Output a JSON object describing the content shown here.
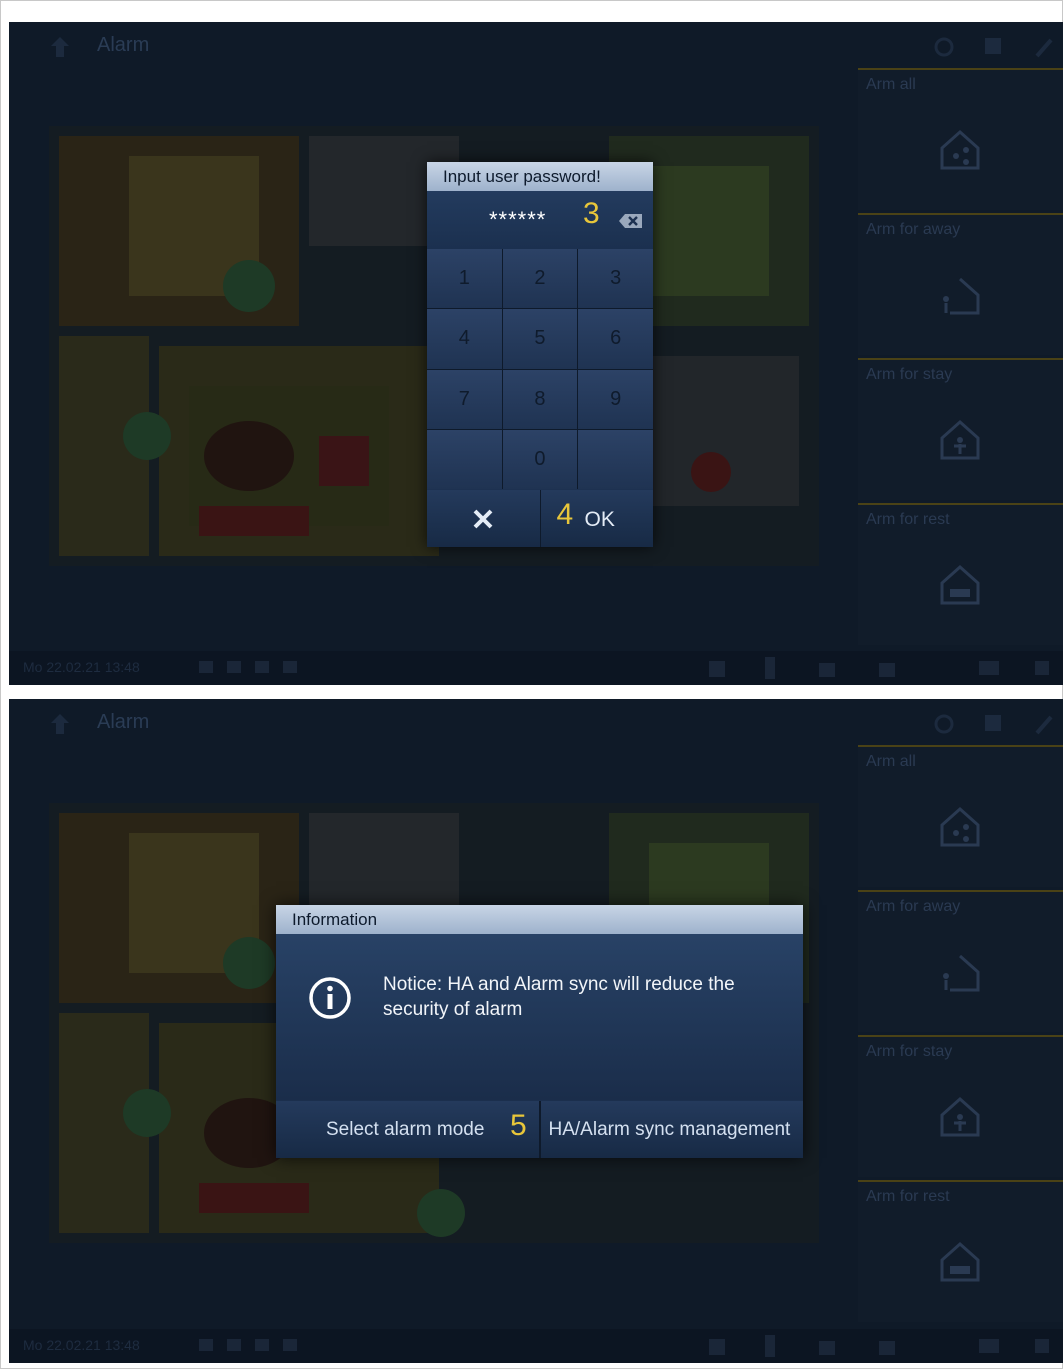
{
  "app": {
    "title": "Alarm"
  },
  "side_menu": [
    {
      "label": "Arm all",
      "icon": "home-share-icon"
    },
    {
      "label": "Arm for away",
      "icon": "home-away-icon"
    },
    {
      "label": "Arm for stay",
      "icon": "home-person-icon"
    },
    {
      "label": "Arm for rest",
      "icon": "home-bed-icon"
    }
  ],
  "status_bar": {
    "datetime": "Mo 22.02.21 13:48"
  },
  "password_dialog": {
    "title": "Input user password!",
    "value": "******",
    "step_label_field": "3",
    "keys": [
      "1",
      "2",
      "3",
      "4",
      "5",
      "6",
      "7",
      "8",
      "9",
      "",
      "0",
      ""
    ],
    "cancel_icon": "close-icon",
    "ok_label": "OK",
    "step_label_ok": "4"
  },
  "info_dialog": {
    "title": "Information",
    "message": "Notice: HA and Alarm sync will reduce the security of alarm",
    "icon": "info-icon",
    "left_button": "Select alarm mode",
    "right_button": "HA/Alarm sync management",
    "step_label": "5"
  },
  "colors": {
    "accent_step": "#e8c63a",
    "dialog_header": "#b4c4d8",
    "background": "#0f1a28"
  }
}
